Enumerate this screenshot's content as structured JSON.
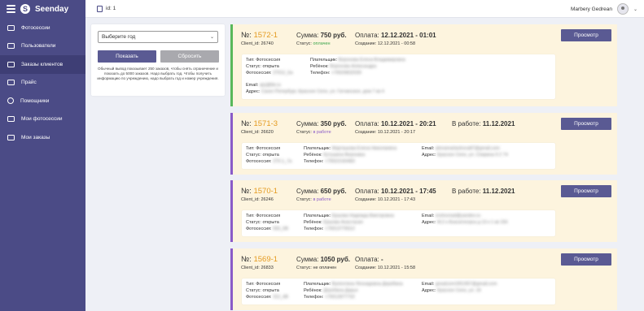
{
  "brand": {
    "name": "Seenday",
    "logo_letter": "S"
  },
  "sidebar": {
    "items": [
      {
        "label": "Фотосессии",
        "icon": "camera-icon",
        "active": false
      },
      {
        "label": "Пользователи",
        "icon": "users-icon",
        "active": false
      },
      {
        "label": "Заказы клиентов",
        "icon": "orders-icon",
        "active": true
      },
      {
        "label": "Прайс",
        "icon": "price-icon",
        "active": false
      },
      {
        "label": "Помощники",
        "icon": "helpers-icon",
        "active": false
      },
      {
        "label": "Мои фотосессии",
        "icon": "my-photos-icon",
        "active": false
      },
      {
        "label": "Мои заказы",
        "icon": "my-orders-icon",
        "active": false
      }
    ]
  },
  "topbar": {
    "id_text": "id: 1",
    "user_name": "Marbery Gedrean"
  },
  "filter": {
    "year_placeholder": "Выберите год",
    "show_label": "Показать",
    "reset_label": "Сбросить",
    "hint": "Обычный вывод показывает 250 заказов, чтобы снять ограничение и показать до 5000 заказов. Надо выбрать год. Чтобы получить информацию по учреждению, надо выбрать год и номер учреждения."
  },
  "labels": {
    "num_prefix": "№:",
    "client_id": "Client_id:",
    "sum": "Сумма:",
    "status": "Статус:",
    "payment": "Оплата:",
    "created": "Создание:",
    "in_work": "В работе:",
    "view_button": "Просмотр",
    "type": "Тип:",
    "payer": "Плательщик:",
    "child": "Ребёнок:",
    "phone": "Телефон:",
    "photoshoot": "Фотосессия:",
    "email": "Email:",
    "address": "Адрес:"
  },
  "orders": [
    {
      "number": "1572-1",
      "client_id": "26740",
      "sum": "750 руб.",
      "status": "оплачен",
      "status_kind": "paid",
      "payment": "12.12.2021 - 01:01",
      "created": "12.12.2021 - 00:58",
      "in_work": "",
      "details": {
        "type": "Фотосессия",
        "status": "открыта",
        "photoshoot": "27012_5a",
        "payer": "Воронова Елена Владимировна",
        "child": "Воронова Александра",
        "phone": "+79029832039",
        "email": "ajcj@bk.ru",
        "address": "Санкт-Петербург, Красное Село, ул. Гатчинское, дом 7 кв 4"
      }
    },
    {
      "number": "1571-3",
      "client_id": "26620",
      "sum": "350 руб.",
      "status": "в работе",
      "status_kind": "work",
      "payment": "10.12.2021 - 20:21",
      "created": "10.12.2021 - 20:17",
      "in_work": "11.12.2021",
      "details": {
        "type": "Фотосессия",
        "status": "открыта",
        "photoshoot": "270-1_7a",
        "payer": "Марташова Елена Николаевна",
        "child": "Кутушина Вероника",
        "phone": "+79022160483",
        "email": "alenamartashova87@gmail.com",
        "address": "Красное Село, ул. Спирина 9 2 74"
      }
    },
    {
      "number": "1570-1",
      "client_id": "26246",
      "sum": "650 руб.",
      "status": "в работе",
      "status_kind": "work",
      "payment": "10.12.2021 - 17:45",
      "created": "10.12.2021 - 17:43",
      "in_work": "11.12.2021",
      "details": {
        "type": "Фотосессия",
        "status": "открыта",
        "photoshoot": "565_5B",
        "payer": "Ершова Надежда Викторовна",
        "child": "Ершова Анастасия",
        "phone": "+79013776512",
        "email": "ershovnad@yandex.ru",
        "address": "М.2 к Бокситогорск д 13 к 1 кв 156"
      }
    },
    {
      "number": "1569-1",
      "client_id": "26833",
      "sum": "1050 руб.",
      "status": "не оплачен",
      "status_kind": "unpaid",
      "payment": "-",
      "created": "10.12.2021 - 15:58",
      "in_work": "",
      "details": {
        "type": "Фотосессия",
        "status": "открыта",
        "photoshoot": "312_4B",
        "payer": "Валентина Леонидовна Дерябина",
        "child": "Дерябина Дарья",
        "phone": "+79012877732",
        "email": "gesalcom1951957@gmail.com",
        "address": "Красное Село, ул. 16"
      }
    }
  ],
  "colors": {
    "sidebar": "#4b4b86",
    "accent": "#5a5a93",
    "order_bg": "#fdf4de",
    "number": "#e49a1f",
    "paid": "#3aa44a",
    "work": "#8a5bc8"
  }
}
